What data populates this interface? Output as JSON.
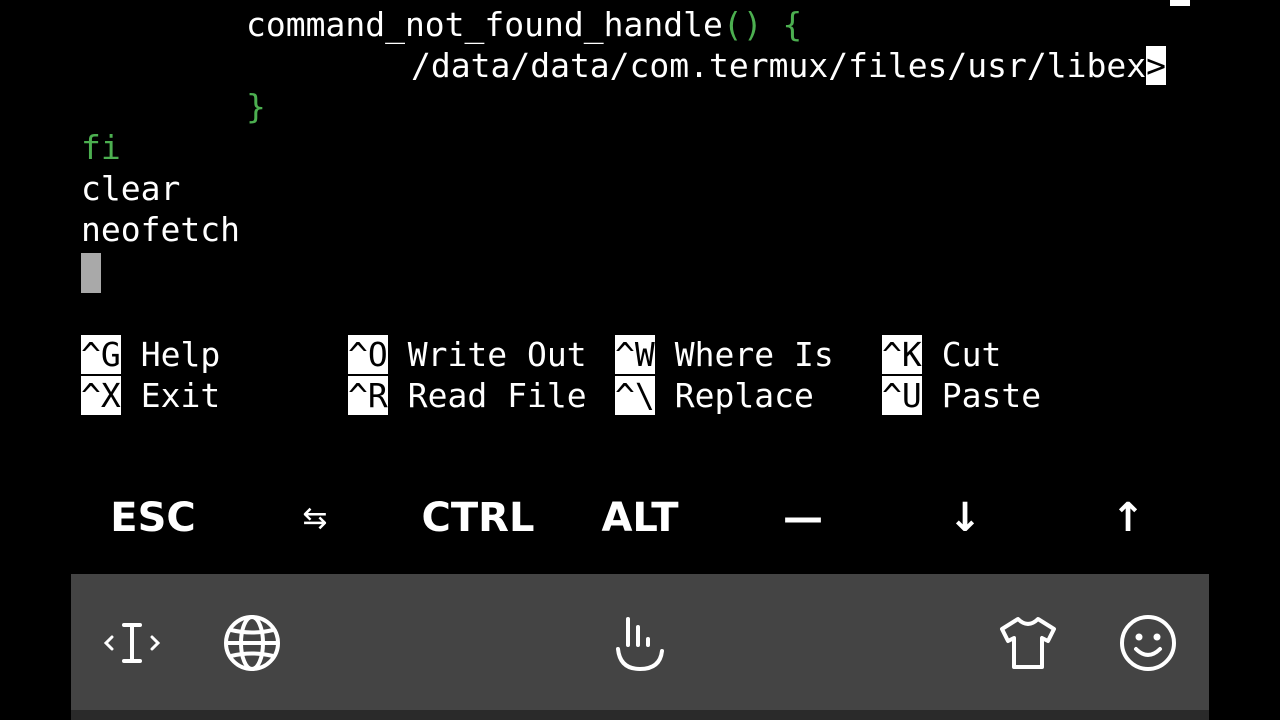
{
  "editor": {
    "lines": [
      {
        "text": "command_not_found_handle",
        "color": "#ffffff"
      },
      {
        "text": "() {",
        "color": "#4caf50"
      },
      {
        "text": "/data/data/com.termux/files/usr/libex",
        "color": "#ffffff"
      },
      {
        "text": ">",
        "color": "#000000"
      },
      {
        "text": "}",
        "color": "#4caf50"
      },
      {
        "text": "fi",
        "color": "#4caf50"
      },
      {
        "text": "clear",
        "color": "#ffffff"
      },
      {
        "text": "neofetch",
        "color": "#ffffff"
      }
    ]
  },
  "shortcuts": [
    {
      "key": "^G",
      "label": "Help"
    },
    {
      "key": "^O",
      "label": "Write Out"
    },
    {
      "key": "^W",
      "label": "Where Is"
    },
    {
      "key": "^K",
      "label": "Cut"
    },
    {
      "key": "^X",
      "label": "Exit"
    },
    {
      "key": "^R",
      "label": "Read File"
    },
    {
      "key": "^\\",
      "label": "Replace"
    },
    {
      "key": "^U",
      "label": "Paste"
    }
  ],
  "extra_keys": [
    {
      "label": "ESC"
    },
    {
      "label": "⇆",
      "icon": "tab-icon"
    },
    {
      "label": "CTRL"
    },
    {
      "label": "ALT"
    },
    {
      "label": "—"
    },
    {
      "label": "↓"
    },
    {
      "label": "↑"
    }
  ],
  "keyboard_toolbar": {
    "icons": [
      "text-cursor-icon",
      "globe-icon",
      "swipe-hand-icon",
      "theme-shirt-icon",
      "emoji-icon"
    ],
    "background": "#444444"
  },
  "colors": {
    "background": "#000000",
    "syntax_green": "#4caf50",
    "cursor": "#a9a9a9"
  }
}
